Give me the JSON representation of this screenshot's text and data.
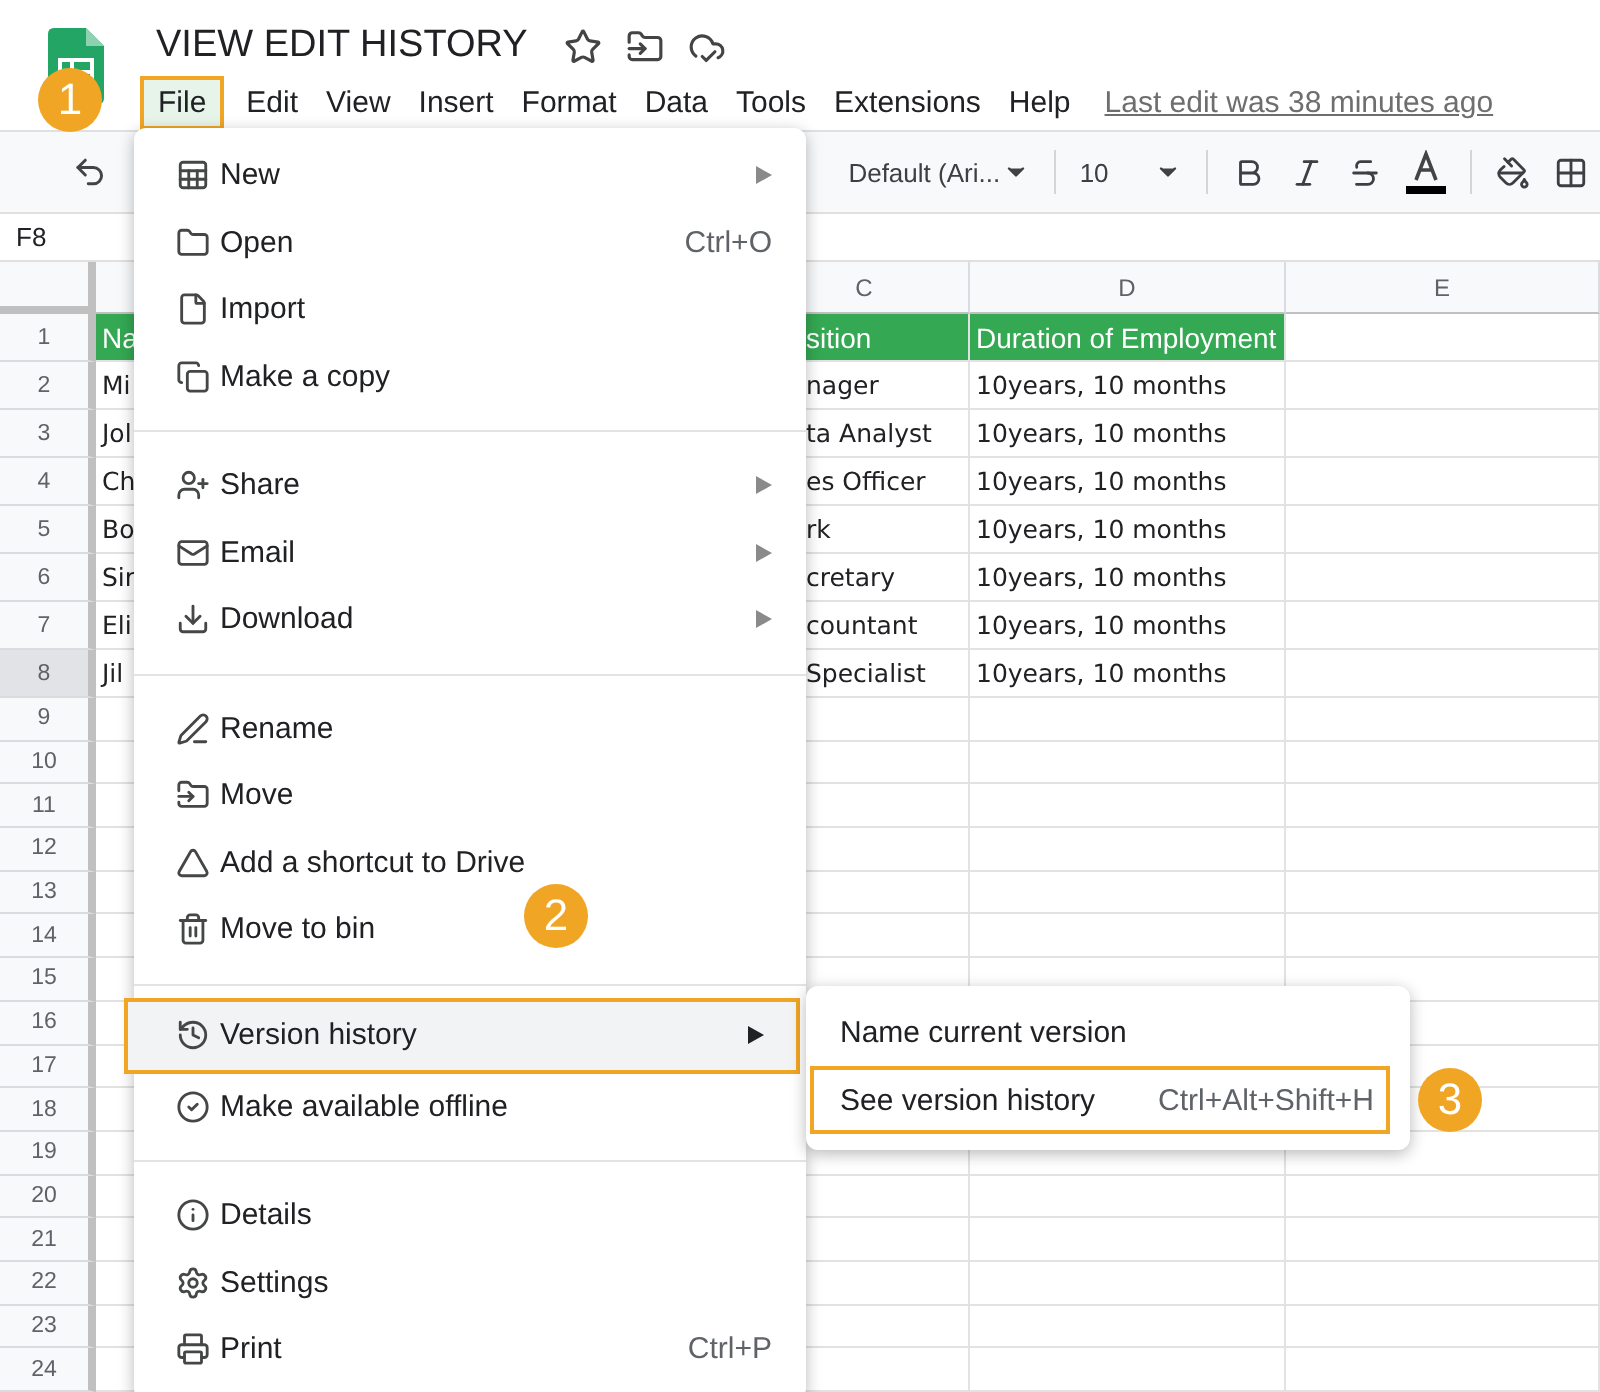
{
  "app": {
    "title": "VIEW EDIT HISTORY",
    "menus": [
      {
        "label": "File",
        "selected": true
      },
      {
        "label": "Edit",
        "selected": false
      },
      {
        "label": "View",
        "selected": false
      },
      {
        "label": "Insert",
        "selected": false
      },
      {
        "label": "Format",
        "selected": false
      },
      {
        "label": "Data",
        "selected": false
      },
      {
        "label": "Tools",
        "selected": false
      },
      {
        "label": "Extensions",
        "selected": false
      },
      {
        "label": "Help",
        "selected": false
      }
    ],
    "last_edit": "Last edit was 38 minutes ago"
  },
  "toolbar": {
    "font": "Default (Ari...",
    "font_size": "10"
  },
  "name_box": "F8",
  "sheet": {
    "columns": [
      "C",
      "D",
      "E"
    ],
    "rows": [
      {
        "number": "1",
        "kind": "header",
        "selected": false,
        "a": "Na",
        "c": "sition",
        "d": "Duration of Employment"
      },
      {
        "number": "2",
        "kind": "data",
        "selected": false,
        "a": "Mi",
        "c": "nager",
        "d": "10years, 10 months"
      },
      {
        "number": "3",
        "kind": "data",
        "selected": false,
        "a": "Jol",
        "c": "ta Analyst",
        "d": "10years, 10 months"
      },
      {
        "number": "4",
        "kind": "data",
        "selected": false,
        "a": "Ch",
        "c": "es Officer",
        "d": "10years, 10 months"
      },
      {
        "number": "5",
        "kind": "data",
        "selected": false,
        "a": "Bo",
        "c": "rk",
        "d": "10years, 10 months"
      },
      {
        "number": "6",
        "kind": "data",
        "selected": false,
        "a": "Sir",
        "c": "cretary",
        "d": "10years, 10 months"
      },
      {
        "number": "7",
        "kind": "data",
        "selected": false,
        "a": "Eli",
        "c": "countant",
        "d": "10years, 10 months"
      },
      {
        "number": "8",
        "kind": "data",
        "selected": true,
        "a": "Jil",
        "c": "Specialist",
        "d": "10years, 10 months"
      },
      {
        "number": "9",
        "kind": "data",
        "selected": false
      },
      {
        "number": "10",
        "kind": "data",
        "selected": false
      },
      {
        "number": "11",
        "kind": "data",
        "selected": false
      },
      {
        "number": "12",
        "kind": "data",
        "selected": false
      },
      {
        "number": "13",
        "kind": "data",
        "selected": false
      },
      {
        "number": "14",
        "kind": "data",
        "selected": false
      },
      {
        "number": "15",
        "kind": "data",
        "selected": false
      },
      {
        "number": "16",
        "kind": "data",
        "selected": false
      },
      {
        "number": "17",
        "kind": "data",
        "selected": false
      },
      {
        "number": "18",
        "kind": "data",
        "selected": false
      },
      {
        "number": "19",
        "kind": "data",
        "selected": false
      },
      {
        "number": "20",
        "kind": "data",
        "selected": false
      },
      {
        "number": "21",
        "kind": "data",
        "selected": false
      },
      {
        "number": "22",
        "kind": "data",
        "selected": false
      },
      {
        "number": "23",
        "kind": "data",
        "selected": false
      },
      {
        "number": "24",
        "kind": "data",
        "selected": false
      }
    ]
  },
  "file_menu": {
    "sections": [
      [
        {
          "label": "New",
          "submenu": true,
          "selected": false
        },
        {
          "label": "Open",
          "shortcut": "Ctrl+O",
          "submenu": false,
          "selected": false
        },
        {
          "label": "Import",
          "submenu": false,
          "selected": false
        },
        {
          "label": "Make a copy",
          "submenu": false,
          "selected": false
        }
      ],
      [
        {
          "label": "Share",
          "submenu": true,
          "selected": false
        },
        {
          "label": "Email",
          "submenu": true,
          "selected": false
        },
        {
          "label": "Download",
          "submenu": true,
          "selected": false
        }
      ],
      [
        {
          "label": "Rename",
          "submenu": false,
          "selected": false
        },
        {
          "label": "Move",
          "submenu": false,
          "selected": false
        },
        {
          "label": "Add a shortcut to Drive",
          "submenu": false,
          "selected": false
        },
        {
          "label": "Move to bin",
          "submenu": false,
          "selected": false
        }
      ],
      [
        {
          "label": "Version history",
          "submenu": true,
          "selected": true
        },
        {
          "label": "Make available offline",
          "submenu": false,
          "selected": false
        }
      ],
      [
        {
          "label": "Details",
          "submenu": false,
          "selected": false
        },
        {
          "label": "Settings",
          "submenu": false,
          "selected": false
        },
        {
          "label": "Print",
          "shortcut": "Ctrl+P",
          "submenu": false,
          "selected": false
        }
      ]
    ]
  },
  "version_submenu": {
    "items": [
      {
        "label": "Name current version",
        "selected": false
      },
      {
        "label": "See version history",
        "shortcut": "Ctrl+Alt+Shift+H",
        "selected": true
      }
    ]
  },
  "callouts": [
    "1",
    "2",
    "3"
  ]
}
